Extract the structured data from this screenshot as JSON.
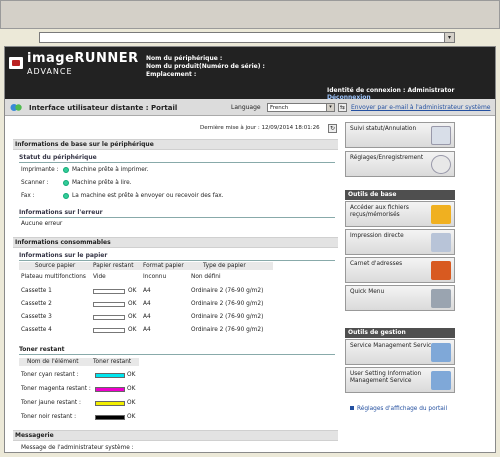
{
  "header": {
    "brand_line1": "imageRUNNER",
    "brand_line2": "ADVANCE",
    "device_name_label": "Nom du périphérique :",
    "product_name_label": "Nom du produit(Numéro de série) :",
    "location_label": "Emplacement :",
    "login_label": "Identité de connexion : Administrator",
    "logout_link": "Déconnexion"
  },
  "portal_bar": {
    "title": "Interface utilisateur distante : Portail",
    "language_label": "Language",
    "language_value": "French",
    "mail_link": "Envoyer par e-mail à l'administrateur système"
  },
  "main": {
    "last_update": "Dernière mise à jour : 12/09/2014 18:01:26",
    "device_info": {
      "title": "Informations de base sur le périphérique",
      "status_title": "Statut du périphérique",
      "rows": [
        {
          "label": "Imprimante :",
          "status": "Machine prête à imprimer."
        },
        {
          "label": "Scanner :",
          "status": "Machine prête à lire."
        },
        {
          "label": "Fax :",
          "status": "La machine est prête à envoyer ou recevoir des fax."
        }
      ],
      "error_title": "Informations sur l'erreur",
      "error_value": "Aucune erreur"
    },
    "consumables": {
      "title": "Informations consommables",
      "paper_title": "Informations sur le papier",
      "paper_headers": [
        "Source papier",
        "Papier restant",
        "Format papier",
        "Type de papier"
      ],
      "paper_rows": [
        {
          "source": "Plateau multifonctions",
          "remaining": "Vide",
          "format": "Inconnu",
          "type": "Non défini",
          "level": null
        },
        {
          "source": "Cassette 1",
          "remaining": "OK",
          "format": "A4",
          "type": "Ordinaire 2 (76-90 g/m2)",
          "level": 0
        },
        {
          "source": "Cassette 2",
          "remaining": "OK",
          "format": "A4",
          "type": "Ordinaire 2 (76-90 g/m2)",
          "level": 0
        },
        {
          "source": "Cassette 3",
          "remaining": "OK",
          "format": "A4",
          "type": "Ordinaire 2 (76-90 g/m2)",
          "level": 0
        },
        {
          "source": "Cassette 4",
          "remaining": "OK",
          "format": "A4",
          "type": "Ordinaire 2 (76-90 g/m2)",
          "level": 0
        }
      ],
      "toner_title": "Toner restant",
      "toner_headers": [
        "Nom de l'élément",
        "Toner restant"
      ],
      "toner_rows": [
        {
          "name": "Toner cyan restant :",
          "status": "OK",
          "color": "#00e5ee"
        },
        {
          "name": "Toner magenta restant :",
          "status": "OK",
          "color": "#ee00cc"
        },
        {
          "name": "Toner jaune restant :",
          "status": "OK",
          "color": "#f2ee00"
        },
        {
          "name": "Toner noir restant :",
          "status": "OK",
          "color": "#000000"
        }
      ]
    },
    "messaging": {
      "title": "Messagerie",
      "admin_message_label": "Message de l'administrateur système :"
    }
  },
  "sidebar": {
    "top_buttons": [
      "Suivi statut/Annulation",
      "Réglages/Enregistrement"
    ],
    "basic_tools_title": "Outils de base",
    "basic_tools": [
      "Accéder aux fichiers reçus/mémorisés",
      "Impression directe",
      "Carnet d'adresses",
      "Quick Menu"
    ],
    "admin_tools_title": "Outils de gestion",
    "admin_tools": [
      "Service Management Service",
      "User Setting Information Management Service"
    ],
    "portal_display_link": "Réglages d'affichage du portail"
  },
  "colors": {
    "header_bg": "#222222",
    "link": "#2450a0",
    "status_ok": "#33cc99"
  }
}
